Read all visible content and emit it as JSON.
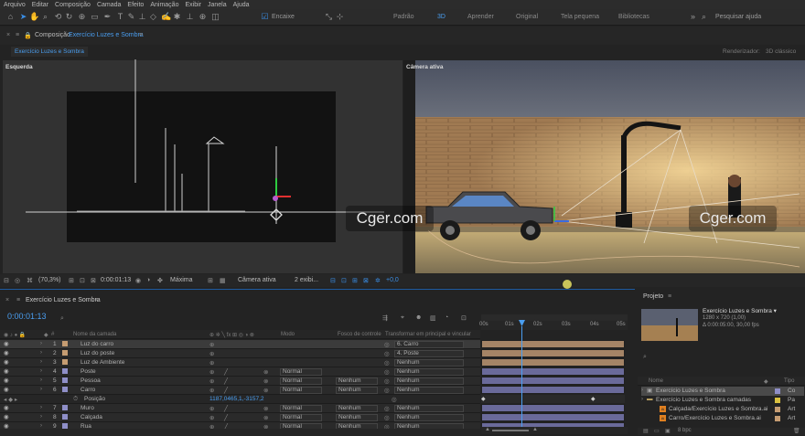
{
  "menu": [
    "Arquivo",
    "Editar",
    "Composição",
    "Camada",
    "Efeito",
    "Animação",
    "Exibir",
    "Janela",
    "Ajuda"
  ],
  "toolbar": {
    "snap_label": "Encaixe",
    "workspaces": [
      "Padrão",
      "3D",
      "Aprender",
      "Original",
      "Tela pequena",
      "Bibliotecas"
    ],
    "search_placeholder": "Pesquisar ajuda"
  },
  "composition": {
    "tab_prefix": "Composição",
    "tab_name": "Exercício Luzes e Sombra",
    "sub_tab": "Exercício Luzes e Sombra",
    "renderer_label": "Renderizador:",
    "renderer_value": "3D clássico",
    "left_view_label": "Esquerda",
    "right_view_label": "Câmera ativa",
    "watermark": "Cger.com"
  },
  "viewer_footer": {
    "zoom": "(70,3%)",
    "timecode": "0:00:01:13",
    "resolution": "Máxima",
    "camera": "Câmera ativa",
    "views": "2 exibi...",
    "exposure": "+0,0"
  },
  "timeline": {
    "tab": "Exercício Luzes e Sombra",
    "timecode": "0:00:01:13",
    "columns": {
      "name": "Nome da camada",
      "mode": "Modo",
      "track": "Fosco de controle",
      "parent": "Transformar em principal e vincular"
    },
    "layers": [
      {
        "num": "1",
        "name": "Luz do carro",
        "color": "#c59c72",
        "mode": "",
        "track": "",
        "parent": "6. Carro",
        "selected": true
      },
      {
        "num": "2",
        "name": "Luz do poste",
        "color": "#c59c72",
        "mode": "",
        "track": "",
        "parent": "4. Poste",
        "selected": false
      },
      {
        "num": "3",
        "name": "Luz de Ambiente",
        "color": "#c59c72",
        "mode": "",
        "track": "",
        "parent": "Nenhum",
        "selected": false
      },
      {
        "num": "4",
        "name": "Poste",
        "color": "#8f8fc8",
        "mode": "Normal",
        "track": "",
        "parent": "Nenhum",
        "selected": false
      },
      {
        "num": "5",
        "name": "Pessoa",
        "color": "#8f8fc8",
        "mode": "Normal",
        "track": "Nenhum",
        "parent": "Nenhum",
        "selected": false
      },
      {
        "num": "6",
        "name": "Carro",
        "color": "#8f8fc8",
        "mode": "Normal",
        "track": "Nenhum",
        "parent": "Nenhum",
        "selected": false
      },
      {
        "num": "",
        "name": "Posição",
        "color": "",
        "mode": "",
        "track": "",
        "parent": "",
        "selected": false,
        "value": "1187,0465,1,-3157,2"
      },
      {
        "num": "7",
        "name": "Muro",
        "color": "#8f8fc8",
        "mode": "Normal",
        "track": "Nenhum",
        "parent": "Nenhum",
        "selected": false
      },
      {
        "num": "8",
        "name": "Calçada",
        "color": "#8f8fc8",
        "mode": "Normal",
        "track": "Nenhum",
        "parent": "Nenhum",
        "selected": false
      },
      {
        "num": "9",
        "name": "Rua",
        "color": "#8f8fc8",
        "mode": "Normal",
        "track": "Nenhum",
        "parent": "Nenhum",
        "selected": false
      }
    ],
    "ruler": [
      "00s",
      "01s",
      "02s",
      "03s",
      "04s",
      "05s"
    ]
  },
  "project": {
    "tab": "Projeto",
    "comp_name": "Exercício Luzes e Sombra ▾",
    "comp_size": "1280 x 720 (1,00)",
    "comp_duration": "Δ 0:00:05:00, 30,00 fps",
    "col_name": "Nome",
    "col_type": "Tipo",
    "items": [
      {
        "name": "Exercício Luzes e Sombra",
        "type": "Co",
        "icon": "comp-icon",
        "selected": true,
        "indent": 0
      },
      {
        "name": "Exercício Luzes e Sombra camadas",
        "type": "Pa",
        "icon": "folder-icon",
        "selected": false,
        "indent": 0
      },
      {
        "name": "Calçada/Exercício Luzes e Sombra.ai",
        "type": "Art",
        "icon": "ai-file-icon",
        "selected": false,
        "indent": 1
      },
      {
        "name": "Carro/Exercício Luzes e Sombra.ai",
        "type": "Art",
        "icon": "ai-file-icon",
        "selected": false,
        "indent": 1
      }
    ],
    "bpc": "8 bpc"
  }
}
